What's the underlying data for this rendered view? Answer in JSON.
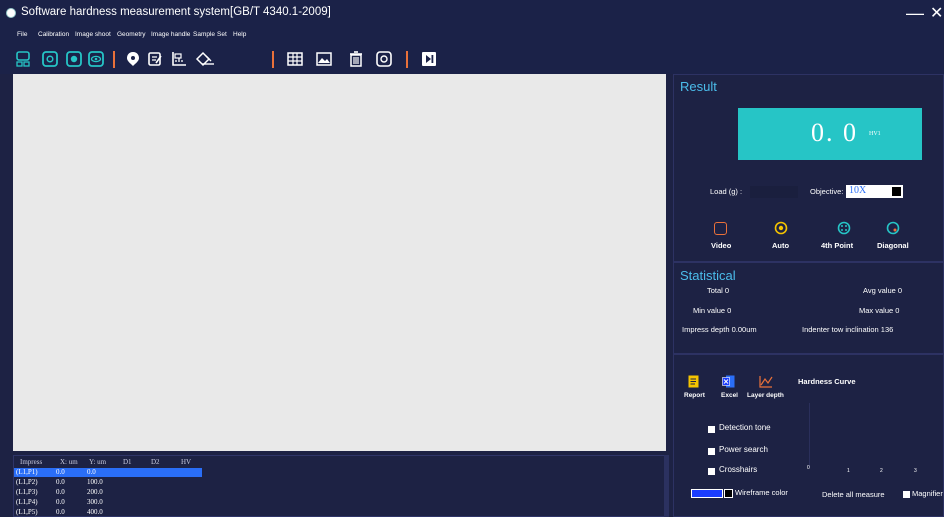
{
  "window": {
    "title": "Software hardness measurement system[GB/T 4340.1-2009]",
    "minimize": "—",
    "close": "✕"
  },
  "menu": [
    "File",
    "Calibration",
    "Image shoot",
    "Geometry",
    "Image handle",
    "Sample",
    "Set",
    "Help"
  ],
  "toolbar_icons": [
    "camera-settings-icon",
    "capture-icon",
    "record-icon",
    "eye-icon",
    "pin-icon",
    "edit-icon",
    "measure-icon",
    "eraser-icon",
    "table-icon",
    "image-icon",
    "delete-icon",
    "circle-icon",
    "play-icon"
  ],
  "table": {
    "headers": [
      "Impress",
      "X: um",
      "Y: um",
      "D1",
      "D2",
      "HV"
    ],
    "rows": [
      {
        "id": "(L1,P1)",
        "x": "0.0",
        "y": "0.0"
      },
      {
        "id": "(L1,P2)",
        "x": "0.0",
        "y": "100.0"
      },
      {
        "id": "(L1,P3)",
        "x": "0.0",
        "y": "200.0"
      },
      {
        "id": "(L1,P4)",
        "x": "0.0",
        "y": "300.0"
      },
      {
        "id": "(L1,P5)",
        "x": "0.0",
        "y": "400.0"
      }
    ]
  },
  "result": {
    "title": "Result",
    "value": "0. 0",
    "unit": "HV1",
    "load_label": "Load (g) :",
    "objective_label": "Objective:",
    "objective_value": "10X",
    "modes": [
      "Video",
      "Auto",
      "4th Point",
      "Diagonal"
    ]
  },
  "statistical": {
    "title": "Statistical",
    "total": "Total 0",
    "avg": "Avg value 0",
    "min": "Min value 0",
    "max": "Max value 0",
    "depth": "Impress depth 0.00um",
    "inclination": "Indenter tow inclination 136"
  },
  "tools": {
    "report": "Report",
    "excel": "Excel",
    "layer": "Layer depth",
    "curve": "Hardness Curve",
    "curve_ticks": [
      "0",
      "1",
      "2",
      "3"
    ],
    "checks": [
      "Detection tone",
      "Power search",
      "Crosshairs"
    ],
    "wireframe": "Wireframe color",
    "delete_all": "Delete all measure",
    "magnifier": "Magnifier"
  },
  "colors": {
    "background": "#1d2244",
    "accent_cyan": "#26c5c6",
    "accent_orange": "#e9713a",
    "title_blue": "#4bbcea",
    "selection_blue": "#2a6ef7",
    "wireframe_color": "#1a3cff"
  }
}
